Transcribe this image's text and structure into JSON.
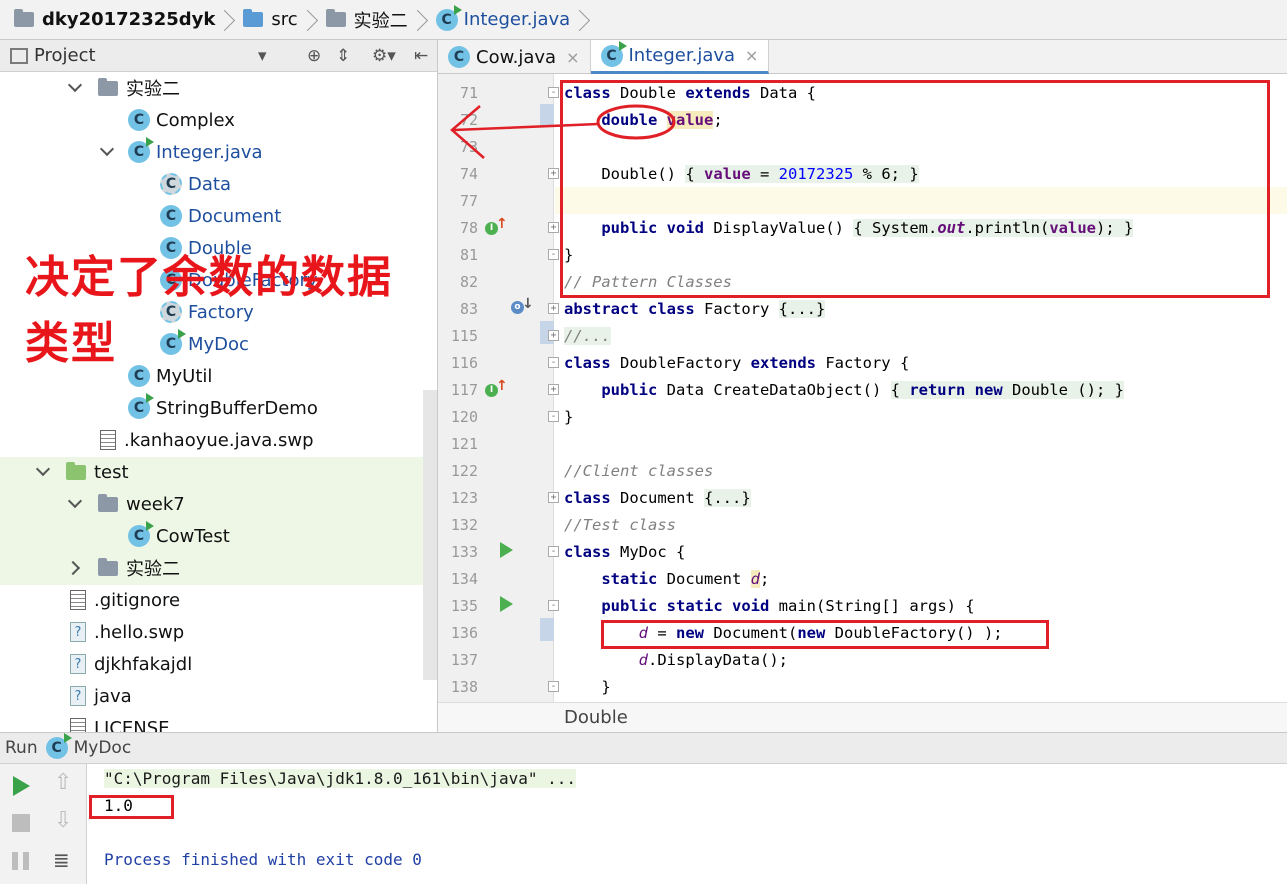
{
  "navbar": {
    "project": "dky20172325dyk",
    "src": "src",
    "pkg": "实验二",
    "file": "Integer.java"
  },
  "project_panel": {
    "title": "Project",
    "tree": [
      {
        "label": "实验二",
        "kind": "folder"
      },
      {
        "label": "Complex",
        "kind": "class"
      },
      {
        "label": "Integer.java",
        "kind": "class-run"
      },
      {
        "label": "Data",
        "kind": "abstract"
      },
      {
        "label": "Document",
        "kind": "class"
      },
      {
        "label": "Double",
        "kind": "class"
      },
      {
        "label": "DoubleFactory",
        "kind": "class"
      },
      {
        "label": "Factory",
        "kind": "abstract"
      },
      {
        "label": "MyDoc",
        "kind": "class-run"
      },
      {
        "label": "MyUtil",
        "kind": "class"
      },
      {
        "label": "StringBufferDemo",
        "kind": "class-run"
      },
      {
        "label": ".kanhaoyue.java.swp",
        "kind": "file"
      },
      {
        "label": "test",
        "kind": "folder-green"
      },
      {
        "label": "week7",
        "kind": "folder"
      },
      {
        "label": "CowTest",
        "kind": "class-run"
      },
      {
        "label": "实验二",
        "kind": "folder"
      },
      {
        "label": ".gitignore",
        "kind": "file"
      },
      {
        "label": ".hello.swp",
        "kind": "unknown"
      },
      {
        "label": "djkhfakajdl",
        "kind": "unknown"
      },
      {
        "label": "java",
        "kind": "unknown"
      },
      {
        "label": "LICENSE",
        "kind": "file"
      }
    ]
  },
  "annotation": {
    "line1": "决定了余数的数据",
    "line2": "类型"
  },
  "tabs": [
    {
      "label": "Cow.java",
      "close": "×"
    },
    {
      "label": "Integer.java",
      "close": "×"
    }
  ],
  "code": {
    "lines": [
      {
        "n": "71"
      },
      {
        "n": "72"
      },
      {
        "n": "73"
      },
      {
        "n": "74"
      },
      {
        "n": "77"
      },
      {
        "n": "78"
      },
      {
        "n": "81"
      },
      {
        "n": "82"
      },
      {
        "n": "83"
      },
      {
        "n": "115"
      },
      {
        "n": "116"
      },
      {
        "n": "117"
      },
      {
        "n": "120"
      },
      {
        "n": "121"
      },
      {
        "n": "122"
      },
      {
        "n": "123"
      },
      {
        "n": "132"
      },
      {
        "n": "133"
      },
      {
        "n": "134"
      },
      {
        "n": "135"
      },
      {
        "n": "136"
      },
      {
        "n": "137"
      },
      {
        "n": "138"
      }
    ],
    "t": {
      "class": "class",
      "extends": "extends",
      "double_name": " Double ",
      "data": " Data {",
      "double_kw": "double",
      "value": "value",
      "semi": ";",
      "ctor": "Double()",
      "ob": "{ ",
      "cb": " }",
      "assign": " = ",
      "num": "20172325",
      "mod": " % 6;",
      "public": "public",
      "void": "void",
      "display": " DisplayValue()",
      "sysout": "System.",
      "out": "out",
      "println": ".println(",
      "close_paren": ");",
      "brace": "}",
      "pattern_cmt": "// Pattern Classes",
      "abstract": "abstract",
      "factory": " Factory ",
      "ellipsis": "{...}",
      "slashdots": "//...",
      "doublefactory": " DoubleFactory ",
      "factory2": " Factory {",
      "createdata": " Data CreateDataObject()",
      "return": "return",
      "new": "new",
      "double_call": " Double ();",
      "client_cmt": "//Client classes",
      "document": " Document ",
      "test_cmt": "//Test class",
      "mydoc": " MyDoc {",
      "static": "static",
      "document2": " Document ",
      "d": "d",
      "main": " main(String[] args) {",
      "docnew": " Document(",
      "dfnew": " DoubleFactory() );",
      "displaydata": ".DisplayData();"
    }
  },
  "editor_breadcrumb": "Double",
  "run": {
    "label": "Run",
    "config": "MyDoc",
    "cmd": "\"C:\\Program Files\\Java\\jdk1.8.0_161\\bin\\java\" ...",
    "output": "1.0",
    "finished": "Process finished with exit code 0"
  },
  "colors": {
    "keyword": "#000080",
    "field": "#660e7a",
    "number": "#0000ff",
    "annotation_red": "#e8161b"
  }
}
